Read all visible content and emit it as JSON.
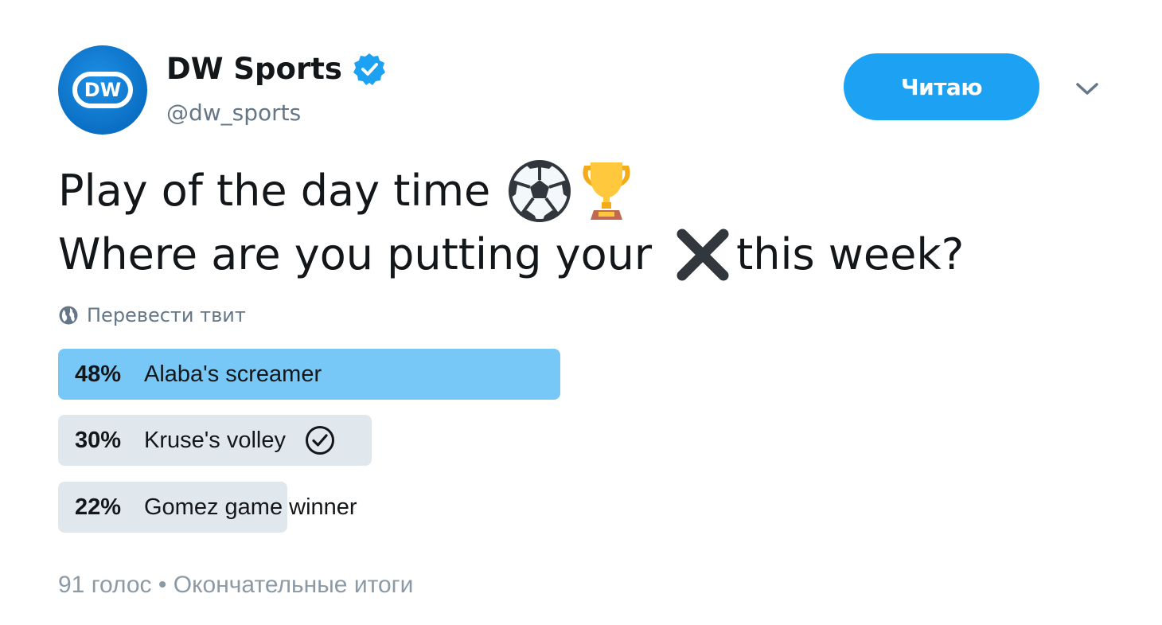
{
  "account": {
    "display_name": "DW Sports",
    "handle": "@dw_sports",
    "avatar_text": "DW",
    "verified": true,
    "brand_color": "#0a6fc4"
  },
  "header": {
    "follow_label": "Читаю",
    "follow_color": "#1da1f2",
    "caret_icon": "chevron-down-icon"
  },
  "tweet": {
    "line1_text": "Play of the day time",
    "line1_emojis": [
      "soccer-ball-icon",
      "trophy-icon"
    ],
    "line2_before": "Where are you putting your",
    "line2_emoji": "cross-mark-icon",
    "line2_after": "this week?"
  },
  "translate": {
    "label": "Перевести твит",
    "icon": "globe-icon"
  },
  "poll": {
    "options": [
      {
        "percent_label": "48%",
        "percent": 48,
        "label": "Alaba's screamer",
        "winner": true,
        "voted": false
      },
      {
        "percent_label": "30%",
        "percent": 30,
        "label": "Kruse's volley",
        "winner": false,
        "voted": true
      },
      {
        "percent_label": "22%",
        "percent": 22,
        "label": "Gomez game winner",
        "winner": false,
        "voted": false
      }
    ],
    "winner_color": "#77c7f7",
    "bar_color": "#e1e8ed",
    "votes": "91 голос",
    "separator": "•",
    "status": "Окончательные итоги"
  }
}
